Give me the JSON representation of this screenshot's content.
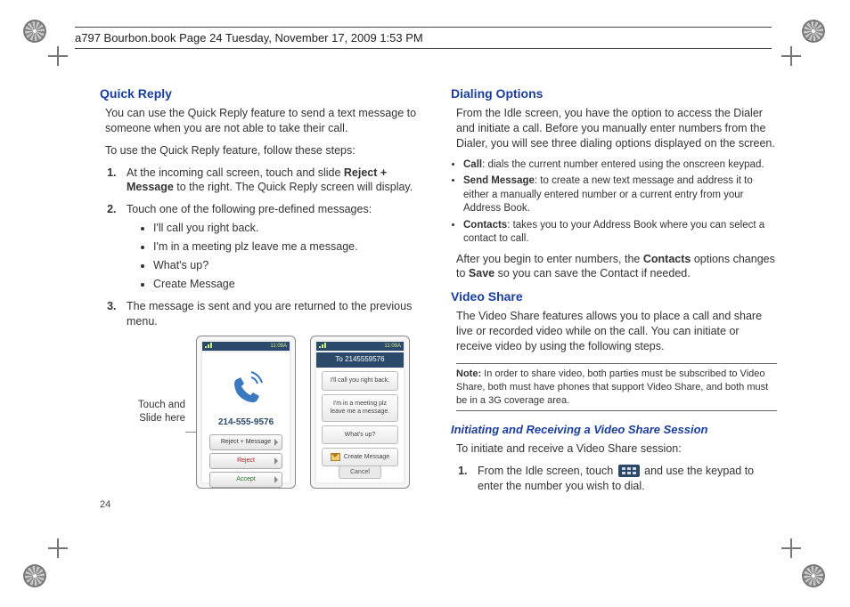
{
  "header": "a797 Bourbon.book  Page 24  Tuesday, November 17, 2009  1:53 PM",
  "page_number": "24",
  "left": {
    "h_quick_reply": "Quick Reply",
    "intro": "You can use the Quick Reply feature to send a text message to someone when you are not able to take their call.",
    "steps_lead": "To use the Quick Reply feature, follow these steps:",
    "step1_a": "At the incoming call screen, touch and slide ",
    "step1_bold": "Reject + Message",
    "step1_b": " to the right. The Quick Reply screen will display.",
    "step2": "Touch one of the following pre-defined messages:",
    "msgs": [
      "I'll call you right back.",
      "I'm in a meeting plz leave me a message.",
      "What's up?",
      "Create Message"
    ],
    "step3": "The message is sent and you are returned to the previous menu.",
    "caption": "Touch and Slide here",
    "phone1": {
      "time": "11:09A",
      "number": "214-555-9576",
      "btn1": "Reject + Message",
      "btn2": "Reject",
      "btn3": "Accept"
    },
    "phone2": {
      "time": "11:09A",
      "to": "To 2145559576",
      "opt1": "I'll call you right back.",
      "opt2": "I'm in a meeting plz leave me a message.",
      "opt3": "What's up?",
      "opt4": "Create Message",
      "softkey": "Cancel"
    }
  },
  "right": {
    "h_dialing": "Dialing Options",
    "dial_intro": "From the Idle screen, you have the option to access the Dialer and initiate a call. Before you manually enter numbers from the Dialer, you will see three dialing options displayed on the screen.",
    "opt_call_b": "Call",
    "opt_call_t": ": dials the current number entered using the onscreen keypad.",
    "opt_send_b": "Send Message",
    "opt_send_t": ": to create a new text message and address it to either a manually entered number or a current entry from your Address Book.",
    "opt_contacts_b": "Contacts",
    "opt_contacts_t": ": takes you to your Address Book where you can select a contact to call.",
    "after_a": "After you begin to enter numbers, the ",
    "after_b1": "Contacts",
    "after_mid": " options changes to ",
    "after_b2": "Save",
    "after_end": " so you can save the Contact if needed.",
    "h_video": "Video Share",
    "video_intro": "The Video Share features allows you to place a call and share live or recorded video while on the call. You can initiate or receive video by using the following steps.",
    "note_label": "Note:",
    "note_text": "In order to share video, both parties must be subscribed to Video Share, both must have phones that support Video Share, and both must be in a 3G coverage area.",
    "h_initiating": "Initiating and Receiving a Video Share Session",
    "init_lead": "To initiate and receive a Video Share session:",
    "init_step1_a": "From the Idle screen, touch ",
    "init_step1_b": " and use the keypad to enter the number you wish to dial."
  }
}
